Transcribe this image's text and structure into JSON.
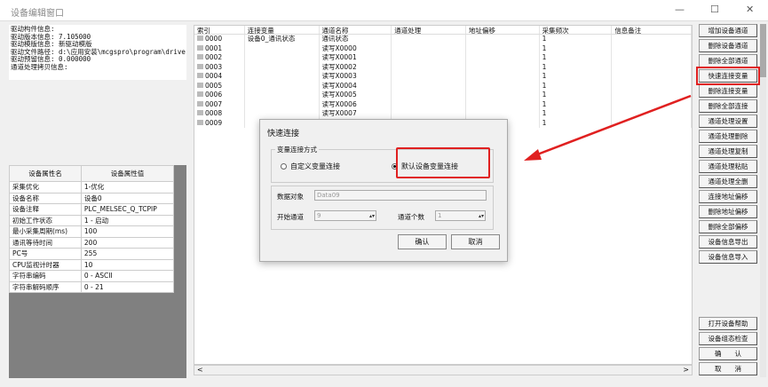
{
  "window": {
    "title": "设备编辑窗口",
    "minimize": "—",
    "maximize": "☐",
    "close": "✕"
  },
  "info_lines": [
    "驱动构件信息:",
    "驱动版本信息: 7.105000",
    "驱动模版信息: 新驱动模版",
    "驱动文件路径: d:\\应用安装\\mcgspro\\program\\drive",
    "驱动预留信息: 0.000000",
    "通道处理拷贝信息:"
  ],
  "props": {
    "headers": [
      "设备属性名",
      "设备属性值"
    ],
    "rows": [
      [
        "采集优化",
        "1-优化"
      ],
      [
        "设备名称",
        "设备0"
      ],
      [
        "设备注释",
        "PLC_MELSEC_Q_TCPIP"
      ],
      [
        "初始工作状态",
        "1 - 启动"
      ],
      [
        "最小采集周期(ms)",
        "100"
      ],
      [
        "通讯等待时间",
        "200"
      ],
      [
        "PC号",
        "255"
      ],
      [
        "CPU监视计时器",
        "10"
      ],
      [
        "字符串编码",
        "0 - ASCII"
      ],
      [
        "字符串解码顺序",
        "0 - 21"
      ]
    ]
  },
  "grid": {
    "headers": [
      "索引",
      "连接变量",
      "通道名称",
      "通道处理",
      "地址偏移",
      "采集频次",
      "信息备注"
    ],
    "rows": [
      [
        "0000",
        "设备0_通讯状态",
        "通讯状态",
        "",
        "",
        "1",
        ""
      ],
      [
        "0001",
        "",
        "读写X0000",
        "",
        "",
        "1",
        ""
      ],
      [
        "0002",
        "",
        "读写X0001",
        "",
        "",
        "1",
        ""
      ],
      [
        "0003",
        "",
        "读写X0002",
        "",
        "",
        "1",
        ""
      ],
      [
        "0004",
        "",
        "读写X0003",
        "",
        "",
        "1",
        ""
      ],
      [
        "0005",
        "",
        "读写X0004",
        "",
        "",
        "1",
        ""
      ],
      [
        "0006",
        "",
        "读写X0005",
        "",
        "",
        "1",
        ""
      ],
      [
        "0007",
        "",
        "读写X0006",
        "",
        "",
        "1",
        ""
      ],
      [
        "0008",
        "",
        "读写X0007",
        "",
        "",
        "1",
        ""
      ],
      [
        "0009",
        "",
        "",
        "",
        "",
        "1",
        ""
      ]
    ]
  },
  "buttons": [
    "增加设备通道",
    "删除设备通道",
    "删除全部通道",
    "快速连接变量",
    "删除连接变量",
    "删除全部连接",
    "通道处理设置",
    "通道处理删除",
    "通道处理复制",
    "通道处理粘贴",
    "通道处理全删",
    "连接地址偏移",
    "删除地址偏移",
    "删除全部偏移",
    "设备信息导出",
    "设备信息导入"
  ],
  "bottom_buttons": [
    "打开设备帮助",
    "设备组态检查",
    "确　　认",
    "取　　消"
  ],
  "dialog": {
    "title": "快速连接",
    "group_label": "变量连接方式",
    "option_custom": "自定义变量连接",
    "option_default": "默认设备变量连接",
    "data_object_label": "数据对象",
    "data_object_value": "Data09",
    "start_channel_label": "开始通道",
    "start_channel_value": "9",
    "channel_count_label": "通道个数",
    "channel_count_value": "1",
    "ok": "确认",
    "cancel": "取消"
  },
  "scroll": {
    "left": "<",
    "right": ">"
  }
}
